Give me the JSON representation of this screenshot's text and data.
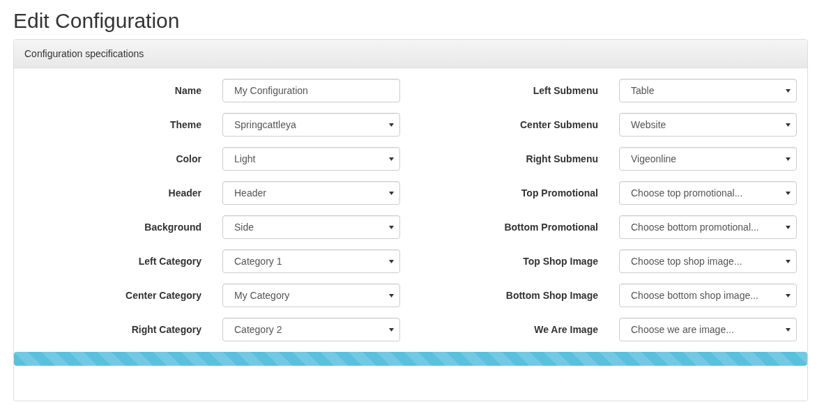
{
  "page_title": "Edit Configuration",
  "panel": {
    "heading": "Configuration specifications",
    "columns": [
      {
        "fields": [
          {
            "label": "Name",
            "kind": "text",
            "value": "My Configuration"
          },
          {
            "label": "Theme",
            "kind": "select",
            "value": "Springcattleya"
          },
          {
            "label": "Color",
            "kind": "select",
            "value": "Light"
          },
          {
            "label": "Header",
            "kind": "select",
            "value": "Header"
          },
          {
            "label": "Background",
            "kind": "select",
            "value": "Side"
          },
          {
            "label": "Left Category",
            "kind": "select",
            "value": "Category 1"
          },
          {
            "label": "Center Category",
            "kind": "select",
            "value": "My Category"
          },
          {
            "label": "Right Category",
            "kind": "select",
            "value": "Category 2"
          }
        ]
      },
      {
        "fields": [
          {
            "label": "Left Submenu",
            "kind": "select",
            "value": "Table"
          },
          {
            "label": "Center Submenu",
            "kind": "select",
            "value": "Website"
          },
          {
            "label": "Right Submenu",
            "kind": "select",
            "value": "Vigeonline"
          },
          {
            "label": "Top Promotional",
            "kind": "select",
            "value": "Choose top promotional..."
          },
          {
            "label": "Bottom Promotional",
            "kind": "select",
            "value": "Choose bottom promotional..."
          },
          {
            "label": "Top Shop Image",
            "kind": "select",
            "value": "Choose top shop image..."
          },
          {
            "label": "Bottom Shop Image",
            "kind": "select",
            "value": "Choose bottom shop image..."
          },
          {
            "label": "We Are Image",
            "kind": "select",
            "value": "Choose we are image..."
          }
        ]
      }
    ]
  },
  "progress": {
    "level": 1
  }
}
